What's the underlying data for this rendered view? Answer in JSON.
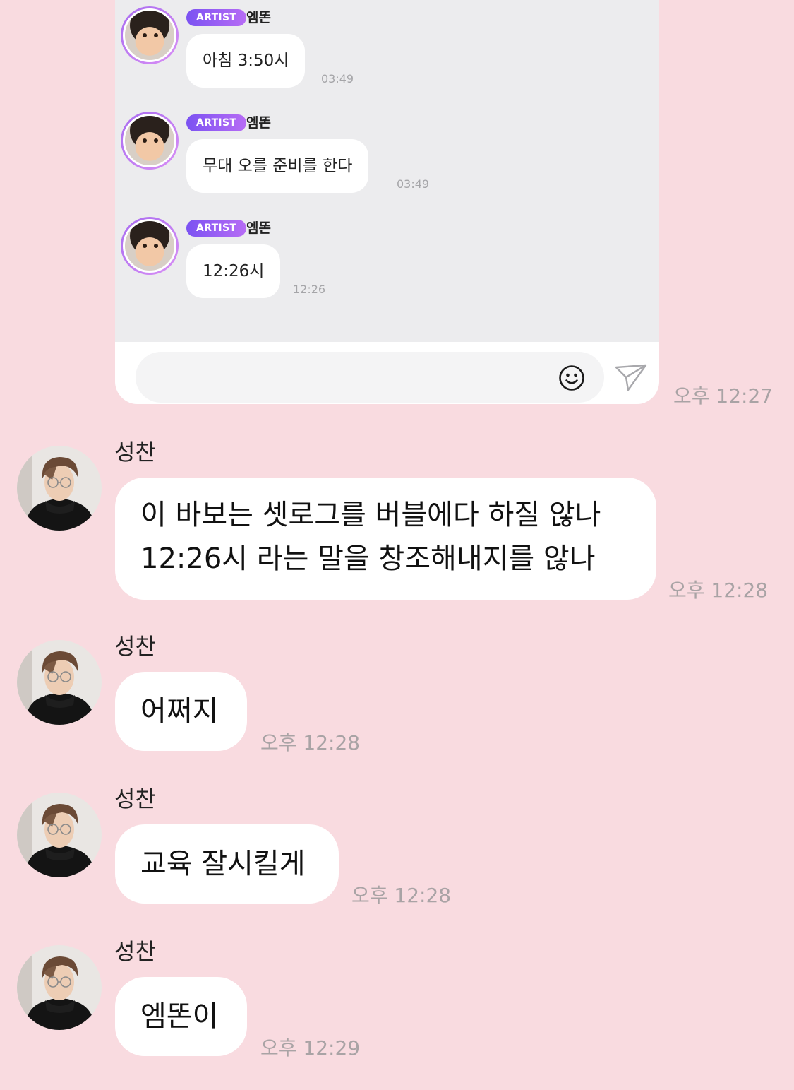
{
  "embedded_screenshot": {
    "messages": [
      {
        "badge": "ARTIST",
        "name": "엠똔",
        "text": "아침 3:50시",
        "time": "03:49"
      },
      {
        "badge": "ARTIST",
        "name": "엠똔",
        "text": "무대 오를 준비를 한다",
        "time": "03:49"
      },
      {
        "badge": "ARTIST",
        "name": "엠똔",
        "text": "12:26시",
        "time": "12:26"
      }
    ],
    "composer": {
      "emoji_icon": "smile-icon",
      "send_icon": "paper-plane-icon"
    }
  },
  "shared_image_time": "오후 12:27",
  "chat": {
    "messages": [
      {
        "sender": "성찬",
        "lines": [
          "이 바보는 셋로그를 버블에다 하질 않나",
          "12:26시 라는 말을 창조해내지를 않나"
        ],
        "time": "오후 12:28"
      },
      {
        "sender": "성찬",
        "lines": [
          "어쩌지"
        ],
        "time": "오후 12:28"
      },
      {
        "sender": "성찬",
        "lines": [
          "교육 잘시킬게"
        ],
        "time": "오후 12:28"
      },
      {
        "sender": "성찬",
        "lines": [
          "엠똔이"
        ],
        "time": "오후 12:29"
      }
    ]
  },
  "colors": {
    "background": "#f9dbe0",
    "bubble": "#ffffff",
    "artist_badge": "#8a5cf3",
    "timestamp": "#a9a3a5"
  }
}
